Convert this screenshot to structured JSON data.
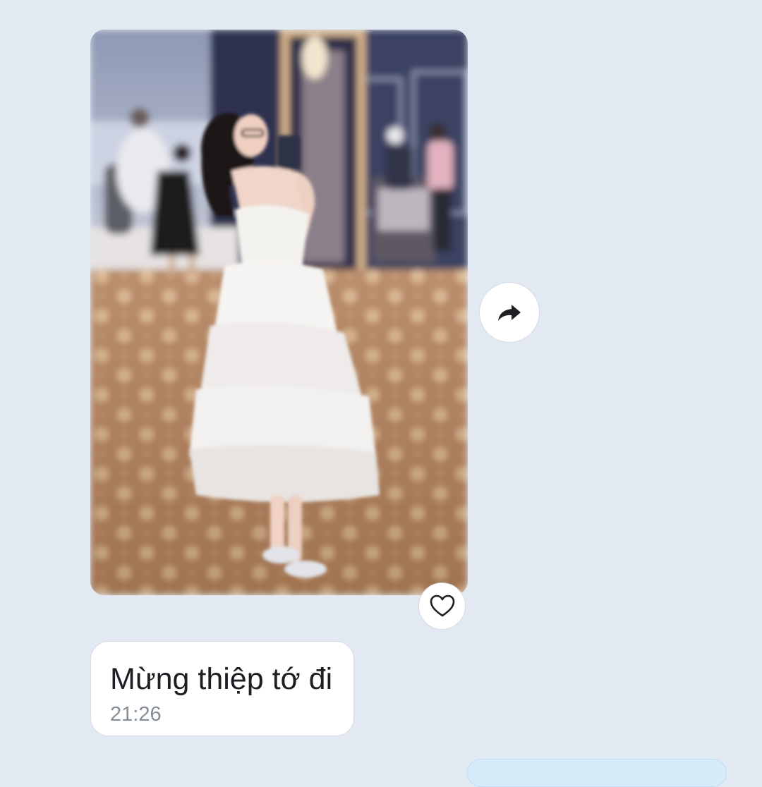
{
  "conversation": {
    "photo_message": {
      "type": "image",
      "alt": ""
    },
    "share_button": {
      "icon": "share-forward-icon"
    },
    "reaction_button": {
      "icon": "heart-outline-icon"
    },
    "text_message": {
      "text": "Mừng thiệp tớ đi",
      "time": "21:26"
    }
  },
  "colors": {
    "background": "#e2e9f2",
    "bubble_incoming": "#ffffff",
    "bubble_outgoing": "#d6ecfb",
    "timestamp": "#858d97",
    "message_text": "#1b1e22"
  }
}
